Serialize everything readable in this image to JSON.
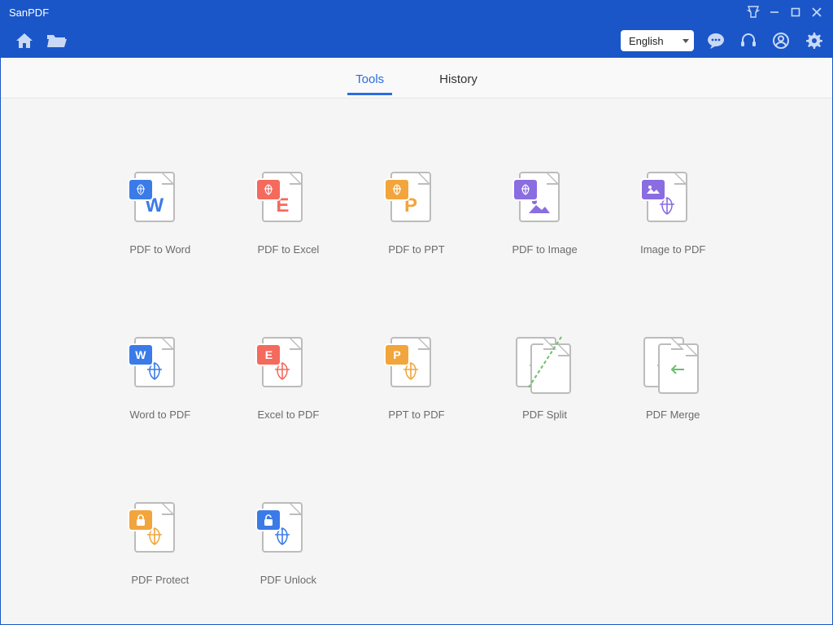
{
  "app": {
    "title": "SanPDF"
  },
  "toolbar": {
    "language": "English"
  },
  "tabs": {
    "tools": "Tools",
    "history": "History",
    "active": "tools"
  },
  "tools": {
    "pdf_to_word": {
      "label": "PDF to Word"
    },
    "pdf_to_excel": {
      "label": "PDF to Excel"
    },
    "pdf_to_ppt": {
      "label": "PDF to PPT"
    },
    "pdf_to_image": {
      "label": "PDF to Image"
    },
    "image_to_pdf": {
      "label": "Image to PDF"
    },
    "word_to_pdf": {
      "label": "Word to PDF"
    },
    "excel_to_pdf": {
      "label": "Excel to PDF"
    },
    "ppt_to_pdf": {
      "label": "PPT to PDF"
    },
    "pdf_split": {
      "label": "PDF Split"
    },
    "pdf_merge": {
      "label": "PDF Merge"
    },
    "pdf_protect": {
      "label": "PDF Protect"
    },
    "pdf_unlock": {
      "label": "PDF Unlock"
    }
  },
  "colors": {
    "accent": "#1a56c8",
    "link": "#2a6de0"
  }
}
